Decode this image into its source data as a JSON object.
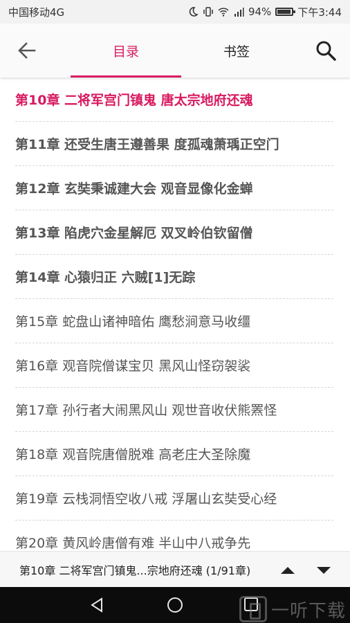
{
  "status_bar": {
    "carrier": "中国移动4G",
    "signal_label": "4G",
    "battery_percent": "94%",
    "battery_level": 0.94,
    "time": "下午3:44",
    "icons": [
      "moon-icon",
      "vibrate-icon",
      "wifi-icon",
      "signal-icon",
      "battery-icon"
    ]
  },
  "app_bar": {
    "back_icon": "arrow-left-icon",
    "tabs": [
      {
        "label": "目录",
        "active": true
      },
      {
        "label": "书签",
        "active": false
      }
    ],
    "search_icon": "search-icon"
  },
  "chapters": [
    {
      "title": "第10章 二将军宫门镇鬼 唐太宗地府还魂",
      "state": "active"
    },
    {
      "title": "第11章 还受生唐王遵善果 度孤魂萧瑀正空门",
      "state": "bold"
    },
    {
      "title": "第12章 玄奘秉诚建大会 观音显像化金蝉",
      "state": "bold"
    },
    {
      "title": "第13章 陷虎穴金星解厄 双叉岭伯钦留僧",
      "state": "bold"
    },
    {
      "title": "第14章 心猿归正 六贼[1]无踪",
      "state": "bold"
    },
    {
      "title": "第15章 蛇盘山诸神暗佑 鹰愁涧意马收缰",
      "state": "normal"
    },
    {
      "title": "第16章 观音院僧谋宝贝 黑风山怪窃袈裟",
      "state": "normal"
    },
    {
      "title": "第17章 孙行者大闹黑风山 观世音收伏熊罴怪",
      "state": "normal"
    },
    {
      "title": "第18章 观音院唐僧脱难 高老庄大圣除魔",
      "state": "normal"
    },
    {
      "title": "第19章 云栈洞悟空收八戒 浮屠山玄奘受心经",
      "state": "normal"
    },
    {
      "title": "第20章 黄风岭唐僧有难 半山中八戒争先",
      "state": "normal"
    }
  ],
  "bottom_bar": {
    "current_chapter": "第10章 二将军宫门镇鬼...宗地府还魂 (1/91章)",
    "up_icon": "triangle-up-icon",
    "down_icon": "triangle-down-icon"
  },
  "nav_bar": {
    "back_icon": "triangle-back-icon",
    "home_icon": "circle-home-icon",
    "recent_icon": "square-recent-icon"
  },
  "watermark": {
    "text": "一听下载"
  },
  "colors": {
    "accent": "#d81b60",
    "text": "#555555",
    "nav_bg": "#0c0c0c"
  }
}
